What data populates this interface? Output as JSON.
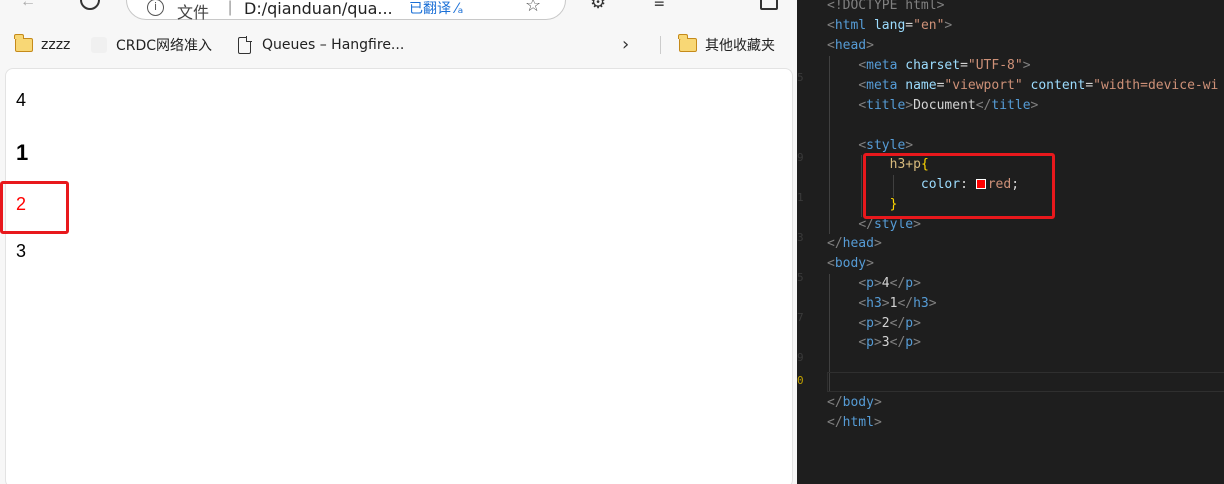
{
  "browser": {
    "address_bar": {
      "file_label": "文件",
      "url": "D:/qianduan/qua...",
      "translate_label": "已翻译"
    },
    "bookmarks": [
      {
        "label": "zzzz",
        "icon": "folder-icon"
      },
      {
        "label": "CRDC网络准入",
        "icon": "page-icon"
      },
      {
        "label": "Queues – Hangfire...",
        "icon": "document-icon"
      }
    ],
    "other_bookmarks": "其他收藏夹",
    "page": {
      "p1": "4",
      "h3": "1",
      "p2": "2",
      "p3": "3"
    },
    "highlight_color": "#e8181c",
    "selected_text_color": "#ff0000"
  },
  "editor": {
    "doctype": "<!DOCTYPE html>",
    "html_lang": "en",
    "meta_charset": "UTF-8",
    "meta_viewport_name": "viewport",
    "meta_viewport_content": "width=device-wi",
    "title": "Document",
    "css_selector": "h3+p",
    "css_property": "color",
    "css_value": "red",
    "body_lines": [
      {
        "tag": "p",
        "text": "4"
      },
      {
        "tag": "h3",
        "text": "1"
      },
      {
        "tag": "p",
        "text": "2"
      },
      {
        "tag": "p",
        "text": "3"
      }
    ]
  }
}
